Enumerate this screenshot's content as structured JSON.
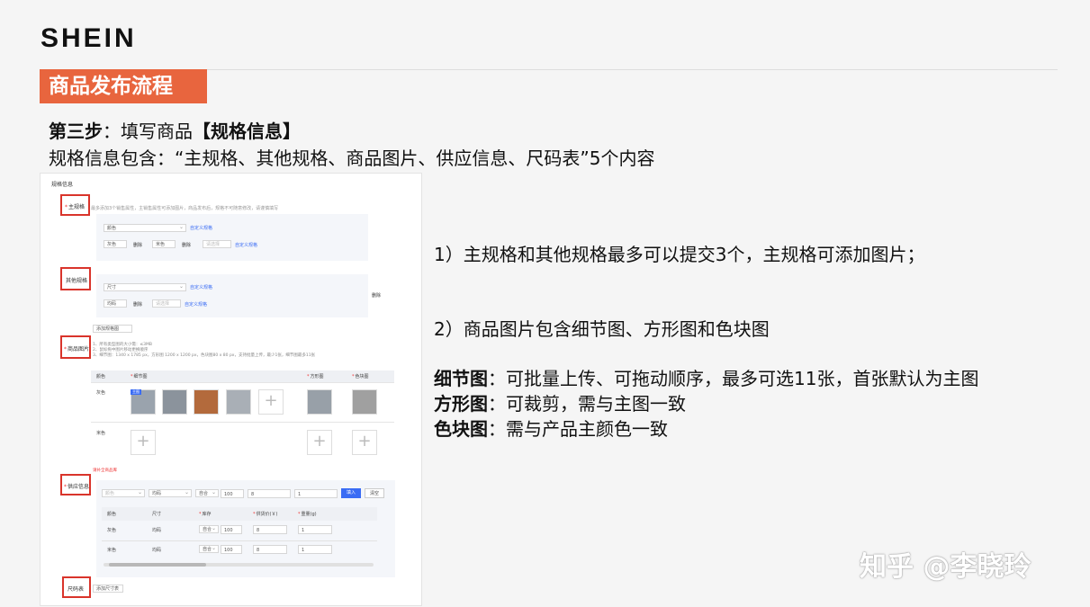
{
  "logo": "SHEIN",
  "section_title": "商品发布流程",
  "step_prefix": "第三步",
  "step_colon": "：填写商品",
  "step_bracket": "【规格信息】",
  "step_description": "规格信息包含：“主规格、其他规格、商品图片、供应信息、尺码表”5个内容",
  "panel": {
    "header": "规格信息",
    "main_spec_label": "主规格",
    "main_spec_hint": "最多添加3个销售属性，主销售属性可添加图片，商品发布后，规格不可随意修改，请谨慎填写",
    "color_select": "颜色",
    "custom_spec_link": "自定义规格",
    "value_grey": "灰色",
    "delete": "删除",
    "value_beige": "米色",
    "please_select": "请选择",
    "custom_spec_link2": "自定义规格",
    "other_spec_label": "其他规格",
    "size_select": "尺寸",
    "value_onesize": "均码",
    "add_spec_button": "添加规格图",
    "images_label": "商品图片",
    "images_hints": [
      "1、所有类型图的大小需：≤3MB",
      "2、鼠标拖中图片移动更换顺序",
      "3、细节图：1340 x 1785 px，方形图 1200 x 1200 px，色块图80 x 80 px，支持批量上传，最少1张，细节图最多11张"
    ],
    "img_table_headers": [
      "颜色",
      "细节图",
      "方形图",
      "色块图"
    ],
    "main_badge": "主图",
    "supply_warning": "请补全商品库",
    "supply_label": "供应信息",
    "supply_filters": [
      "颜色",
      "均码",
      "自合",
      "100",
      "8",
      "1"
    ],
    "fill_button": "填入",
    "clear_button": "清空",
    "supply_headers": [
      "颜色",
      "尺寸",
      "库存",
      "供货价(￥)",
      "重量(g)"
    ],
    "supply_rows": [
      [
        "灰色",
        "均码",
        "自合",
        "100",
        "8",
        "1"
      ],
      [
        "米色",
        "均码",
        "自合",
        "100",
        "8",
        "1"
      ]
    ],
    "size_chart_label": "尺码表",
    "add_size_chart": "添加尺寸表"
  },
  "note1": "1）主规格和其他规格最多可以提交3个，主规格可添加图片；",
  "note2": "2）商品图片包含细节图、方形图和色块图",
  "details": [
    {
      "term": "细节图",
      "text": "：可批量上传、可拖动顺序，最多可选11张，首张默认为主图"
    },
    {
      "term": "方形图",
      "text": "：可裁剪，需与主图一致"
    },
    {
      "term": "色块图",
      "text": "：需与产品主颜色一致"
    }
  ],
  "watermark": "知乎 @李晓玲",
  "colors": {
    "accent": "#e8653e",
    "highlight_box": "#d9342b",
    "link": "#3a6cf4"
  }
}
